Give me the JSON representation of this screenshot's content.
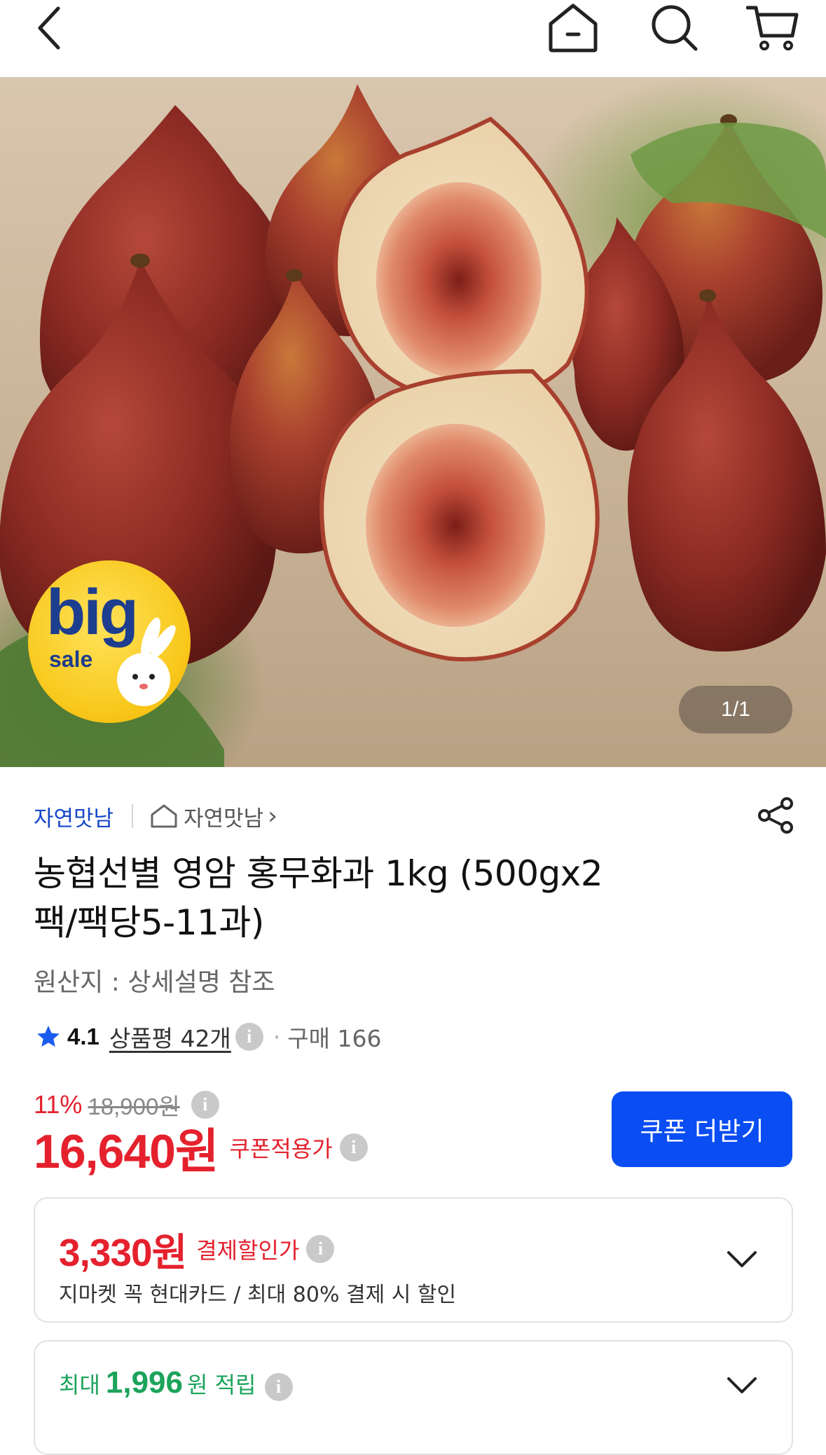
{
  "top_nav": {
    "back_icon": "chevron-left-icon",
    "home_icon": "home-icon",
    "search_icon": "search-icon",
    "cart_icon": "cart-icon"
  },
  "hero": {
    "image_counter": "1/1",
    "badge": {
      "big": "big",
      "sale": "sale"
    }
  },
  "seller": {
    "name": "자연맛남",
    "store_link": "자연맛남",
    "store_chevron": "›"
  },
  "product": {
    "title_line1": "농협선별 영암 홍무화과 1kg (500gx2",
    "title_line2": "팩/팩당5-11과)",
    "origin": "원산지 : 상세설명 참조"
  },
  "rating": {
    "score": "4.1",
    "review_link": "상품평 42개",
    "purchase": "구매 166"
  },
  "price": {
    "discount_rate": "11%",
    "original_price": "18,900원",
    "coupon_price": "16,640원",
    "coupon_price_label": "쿠폰적용가",
    "coupon_button": "쿠폰 더받기"
  },
  "payment_card": {
    "price": "3,330원",
    "label": "결제할인가",
    "description": "지마켓 꼭 현대카드 / 최대 80% 결제 시 할인"
  },
  "points_card": {
    "prefix": "최대",
    "amount": "1,996",
    "suffix": "원 적립"
  },
  "colors": {
    "accent_blue": "#0a4df2",
    "price_red": "#e4212d",
    "points_green": "#1ba35a",
    "seller_blue": "#1547c9"
  }
}
